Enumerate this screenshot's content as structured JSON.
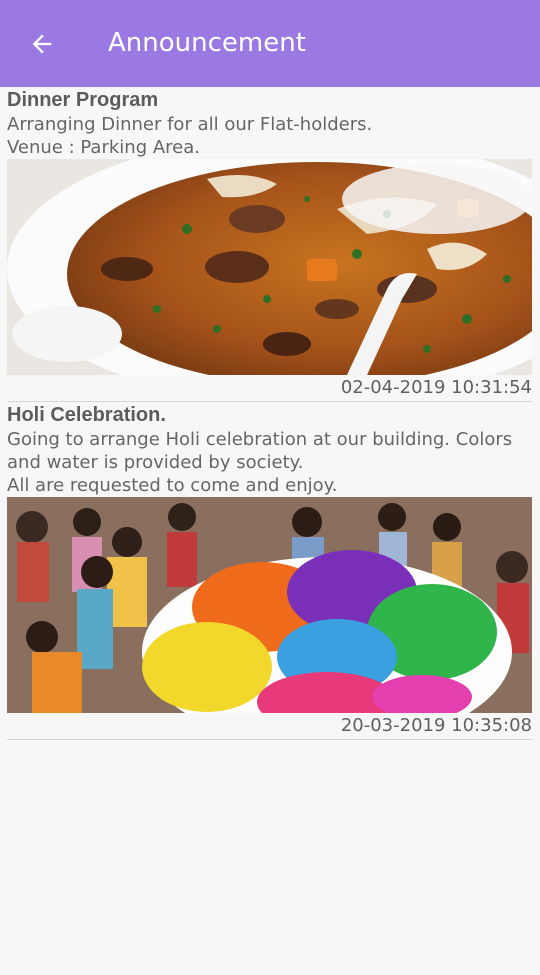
{
  "appbar": {
    "title": "Announcement",
    "back_icon": "arrow-left-icon",
    "color": "#9b79e3"
  },
  "announcements": [
    {
      "title": "Dinner Program",
      "description": "Arranging Dinner for all our Flat-holders.\nVenue : Parking Area.",
      "image": "soup-bowl-photo",
      "timestamp": "02-04-2019 10:31:54"
    },
    {
      "title": "Holi Celebration.",
      "description": "Going to arrange Holi celebration at our building. Colors and water is provided by society.\nAll are requested to come and enjoy.",
      "image": "holi-colors-photo",
      "timestamp": "20-03-2019 10:35:08"
    }
  ]
}
